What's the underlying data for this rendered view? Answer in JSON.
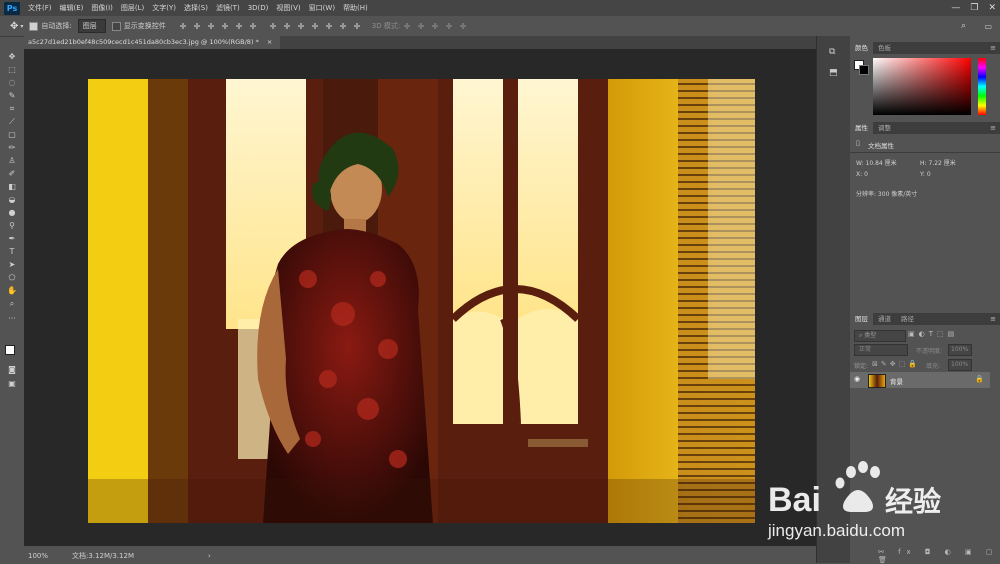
{
  "app": {
    "logo": "Ps"
  },
  "menu": [
    "文件(F)",
    "编辑(E)",
    "图像(I)",
    "图层(L)",
    "文字(Y)",
    "选择(S)",
    "滤镜(T)",
    "3D(D)",
    "视图(V)",
    "窗口(W)",
    "帮助(H)"
  ],
  "window_controls": [
    "—",
    "❐",
    "✕"
  ],
  "options": {
    "auto_select_label": "自动选择:",
    "auto_select_value": "图层",
    "show_transform_label": "显示变换控件",
    "mode_3d_label": "3D 模式:"
  },
  "document": {
    "tab_title": "a5c27d1ed21b0ef48c509cecd1c451da80cb3ec3.jpg @ 100%(RGB/8) *",
    "tab_close": "×"
  },
  "status": {
    "zoom": "100%",
    "doc_size": "文档:3.12M/3.12M",
    "arrow": "›"
  },
  "color_panel": {
    "tabs": [
      "颜色",
      "色板"
    ]
  },
  "properties_panel": {
    "tabs": [
      "属性",
      "调整"
    ],
    "title": "文档属性",
    "w_label": "W:",
    "w_value": "10.84 厘米",
    "h_label": "H:",
    "h_value": "7.22 厘米",
    "x_label": "X:",
    "x_value": "0",
    "y_label": "Y:",
    "y_value": "0",
    "resolution": "分辨率: 300 像素/英寸"
  },
  "layers_panel": {
    "tabs": [
      "图层",
      "通道",
      "路径"
    ],
    "filter_placeholder": "类型",
    "blend_mode": "正常",
    "opacity_label": "不透明度:",
    "opacity_value": "100%",
    "lock_label": "锁定:",
    "fill_label": "填充:",
    "fill_value": "100%",
    "layer_name": "背景"
  },
  "watermark": {
    "brand_left": "Bai",
    "brand_right": "经验",
    "url": "jingyan.baidu.com"
  },
  "colors": {
    "accent": "#31a8ff",
    "photo_yellow": "#f2c40c",
    "photo_wood": "#5a1e0e"
  }
}
